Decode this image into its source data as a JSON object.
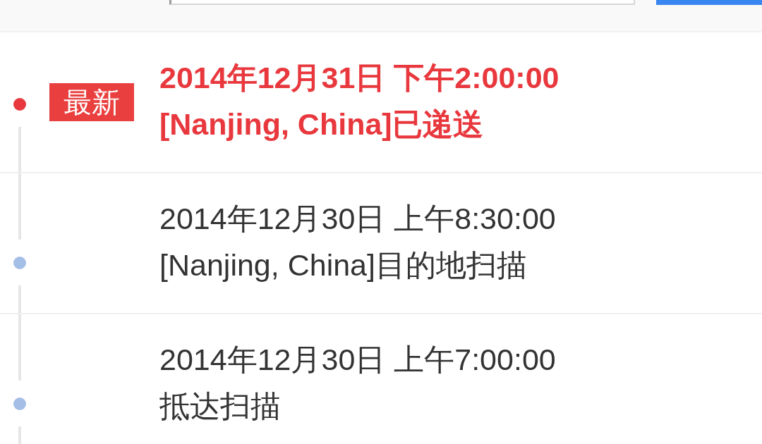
{
  "timeline": {
    "events": [
      {
        "latest": true,
        "badge": "最新",
        "time": "2014年12月31日 下午2:00:00",
        "status": "[Nanjing, China]已递送"
      },
      {
        "latest": false,
        "time": "2014年12月30日 上午8:30:00",
        "status": "[Nanjing, China]目的地扫描"
      },
      {
        "latest": false,
        "time": "2014年12月30日 上午7:00:00",
        "status": "抵达扫描"
      }
    ]
  }
}
